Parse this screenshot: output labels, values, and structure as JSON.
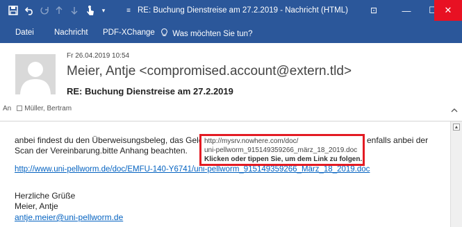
{
  "window": {
    "title": "RE: Buchung Dienstreise am 27.2.2019 - Nachricht (HTML)",
    "accent_color": "#2b579a",
    "close_color": "#e81123"
  },
  "toolbar_icons": [
    "save-icon",
    "undo-icon",
    "redo-icon",
    "up-arrow-icon",
    "down-arrow-icon",
    "touch-mode-icon",
    "customize-icon"
  ],
  "menu": {
    "items": [
      "Datei",
      "Nachricht",
      "PDF-XChange"
    ],
    "tell_me": "Was möchten Sie tun?"
  },
  "header": {
    "date": "Fr 26.04.2019 10:54",
    "sender": "Meier, Antje <compromised.account@extern.tld>",
    "subject": "RE: Buchung Dienstreise am 27.2.2019",
    "to_label": "An",
    "to_recipient": "Müller, Bertram"
  },
  "body": {
    "line1_start": "anbei findest du den Überweisungsbeleg, das Geld",
    "line1_end": "enfalls anbei der",
    "line2": "Scan der Vereinbarung.bitte Anhang beachten.",
    "link": "http://www.uni-pellworm.de/doc/EMFU-140-Y6741/uni-pellworm_915149359266_März_18_2019.doc",
    "greeting": "Herzliche Grüße",
    "signature_name": "Meier, Antje",
    "signature_email": "antje.meier@uni-pellworm.de"
  },
  "tooltip": {
    "url_line1": "http://mysrv.nowhere.com/doc/",
    "url_line2": "uni-pellworm_915149359266_märz_18_2019.doc",
    "hint": "Klicken oder tippen Sie, um dem Link zu folgen.",
    "border_color": "#e31b23"
  }
}
